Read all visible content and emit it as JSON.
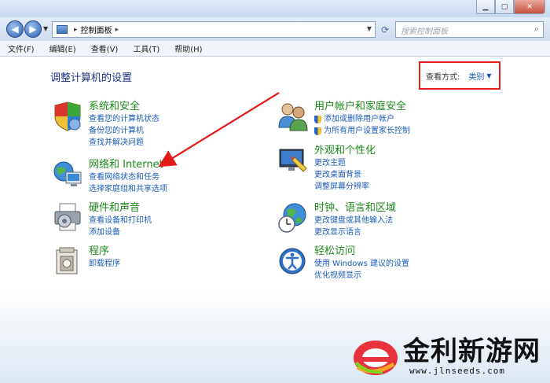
{
  "window": {
    "minimize_glyph": "▁",
    "maximize_glyph": "▢",
    "close_glyph": "✕"
  },
  "nav": {
    "back_glyph": "◀",
    "forward_glyph": "▶",
    "dropdown_glyph": "▼",
    "address_separator": "▸",
    "address_path": "控制面板",
    "refresh_glyph": "⟳",
    "search_placeholder": "搜索控制面板"
  },
  "menu": [
    "文件(F)",
    "编辑(E)",
    "查看(V)",
    "工具(T)",
    "帮助(H)"
  ],
  "page": {
    "title": "调整计算机的设置",
    "view_by_label": "查看方式:",
    "view_by_value": "类别",
    "view_by_caret": "▼"
  },
  "categories": [
    {
      "title": "系统和安全",
      "links": [
        "查看您的计算机状态",
        "备份您的计算机",
        "查找并解决问题"
      ],
      "icon": "shield-icon"
    },
    {
      "title": "网络和 Internet",
      "links": [
        "查看网络状态和任务",
        "选择家庭组和共享选项"
      ],
      "icon": "network-icon"
    },
    {
      "title": "硬件和声音",
      "links": [
        "查看设备和打印机",
        "添加设备"
      ],
      "icon": "printer-icon"
    },
    {
      "title": "程序",
      "links": [
        "卸载程序"
      ],
      "icon": "programs-icon"
    },
    {
      "title": "用户帐户和家庭安全",
      "links": [
        "添加或删除用户帐户",
        "为所有用户设置家长控制"
      ],
      "icon": "users-icon"
    },
    {
      "title": "外观和个性化",
      "links": [
        "更改主题",
        "更改桌面背景",
        "调整屏幕分辨率"
      ],
      "icon": "appearance-icon"
    },
    {
      "title": "时钟、语言和区域",
      "links": [
        "更改键盘或其他输入法",
        "更改显示语言"
      ],
      "icon": "clock-globe-icon"
    },
    {
      "title": "轻松访问",
      "links": [
        "使用 Windows 建议的设置",
        "优化视频显示"
      ],
      "icon": "ease-of-access-icon"
    }
  ],
  "watermark": {
    "name": "金利新游网",
    "url": "www.jlnseeds.com"
  },
  "colors": {
    "link": "#1b5bb5",
    "category_title": "#1e8a1a",
    "highlight_box": "#e21b1b",
    "page_title": "#1e3287"
  }
}
